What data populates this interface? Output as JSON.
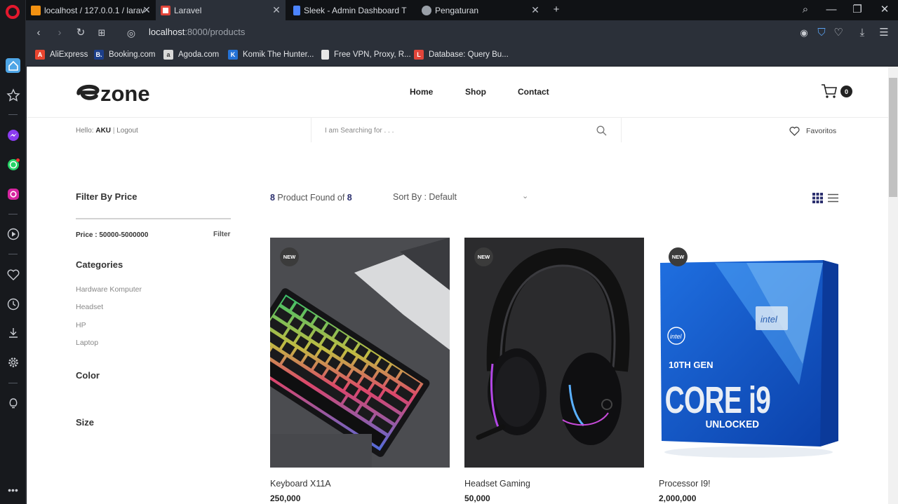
{
  "browser": {
    "tabs": [
      {
        "title": "localhost / 127.0.0.1 / larav",
        "active": false
      },
      {
        "title": "Laravel",
        "active": true
      },
      {
        "title": "Sleek - Admin Dashboard T",
        "active": false
      },
      {
        "title": "Pengaturan",
        "active": false
      }
    ],
    "url_host": "localhost",
    "url_rest": ":8000/products",
    "bookmarks": [
      {
        "label": "AliExpress",
        "icon": "aliexpress-icon",
        "color": "#e8452f"
      },
      {
        "label": "Booking.com",
        "icon": "booking-icon",
        "color": "#1c3f8a"
      },
      {
        "label": "Agoda.com",
        "icon": "agoda-icon",
        "color": "#d9d9d9"
      },
      {
        "label": "Komik The Hunter...",
        "icon": "komik-icon",
        "color": "#2472d6"
      },
      {
        "label": "Free VPN, Proxy, R...",
        "icon": "page-icon",
        "color": "#e6e6e6"
      },
      {
        "label": "Database: Query Bu...",
        "icon": "laravel-icon",
        "color": "#e2453a"
      }
    ]
  },
  "site": {
    "logo": "zone",
    "nav": [
      "Home",
      "Shop",
      "Contact"
    ],
    "cart_count": "0",
    "hello_prefix": "Hello: ",
    "user": "AKU",
    "logout": "Logout",
    "search_placeholder": "I am Searching for . . .",
    "favorites": "Favoritos"
  },
  "sidebar": {
    "filter_title": "Filter By Price",
    "price_text": "Price : 50000-5000000",
    "filter_button": "Filter",
    "categories_title": "Categories",
    "categories": [
      "Hardware Komputer",
      "Headset",
      "HP",
      "Laptop"
    ],
    "color_title": "Color",
    "size_title": "Size"
  },
  "listing": {
    "found_count": "8",
    "found_middle": " Product Found of ",
    "found_total": "8",
    "sort_label": "Sort By : Default",
    "products": [
      {
        "name": "Keyboard X11A",
        "price": "250,000",
        "badge": "NEW"
      },
      {
        "name": "Headset Gaming",
        "price": "50,000",
        "badge": "NEW"
      },
      {
        "name": "Processor I9!",
        "price": "2,000,000",
        "badge": "NEW"
      }
    ]
  }
}
